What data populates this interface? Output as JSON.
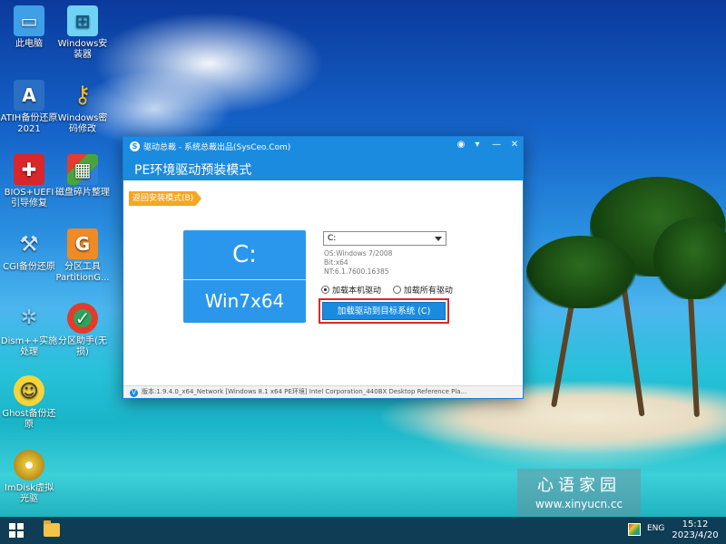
{
  "desktop": {
    "icons": [
      {
        "label": "此电脑",
        "icon": "computer-icon",
        "color": "#3fa0e8"
      },
      {
        "label": "Windows安装器",
        "icon": "windows-installer-icon",
        "color": "#6fd3f5"
      },
      {
        "label": "ATIH备份还原2021",
        "icon": "atih-backup-icon",
        "color": "#2a6fc4"
      },
      {
        "label": "Windows密码修改",
        "icon": "key-icon",
        "color": "#f2b82b"
      },
      {
        "label": "BIOS+UEFI引导修复",
        "icon": "boot-repair-icon",
        "color": "#d9262a"
      },
      {
        "label": "磁盘碎片整理",
        "icon": "defrag-icon",
        "color": "#49a53b"
      },
      {
        "label": "CGI备份还原",
        "icon": "cgi-backup-icon",
        "color": "#3a7fd0"
      },
      {
        "label": "分区工具PartitionG...",
        "icon": "partition-tool-icon",
        "color": "#f08a24"
      },
      {
        "label": "Dism++实施处理",
        "icon": "dism-icon",
        "color": "#2f8fdc"
      },
      {
        "label": "分区助手(无损)",
        "icon": "partition-assistant-icon",
        "color": "#2aa65a"
      },
      {
        "label": "Ghost备份还原",
        "icon": "ghost-icon",
        "color": "#f5d53b"
      },
      {
        "label": "ImDisk虚拟光驱",
        "icon": "imdisk-icon",
        "color": "#e9c537"
      }
    ]
  },
  "dialog": {
    "window_title": "驱动总裁 - 系统总裁出品(SysCeo.Com)",
    "heading": "PE环境驱动预装模式",
    "tab_label": "返回安装模式(B)",
    "drive_letter": "C:",
    "os_label": "Win7x64",
    "drive_select_value": "C:",
    "info_os": "OS:Windows 7/2008",
    "info_bit": "Bit:x64",
    "info_nt": "NT:6.1.7600.16385",
    "radio_local": "加载本机驱动",
    "radio_all": "加载所有驱动",
    "load_button": "加载驱动到目标系统 (C)",
    "status_text": "版本:1.9.4.0_x64_Network [Windows 8.1 x64 PE环境] Intel Corporation_440BX Desktop Reference Pla...",
    "status_icon_letter": "V",
    "app_icon_letter": "S",
    "buttons": {
      "minimize": "—",
      "maximize": "▭",
      "close": "✕",
      "menu": "▾",
      "skin": "◉"
    }
  },
  "watermark": {
    "cn_text": "心语家园",
    "url": "www.xinyucn.cc"
  },
  "taskbar": {
    "language": "ENG",
    "time": "15:12",
    "date": "2023/4/20"
  }
}
